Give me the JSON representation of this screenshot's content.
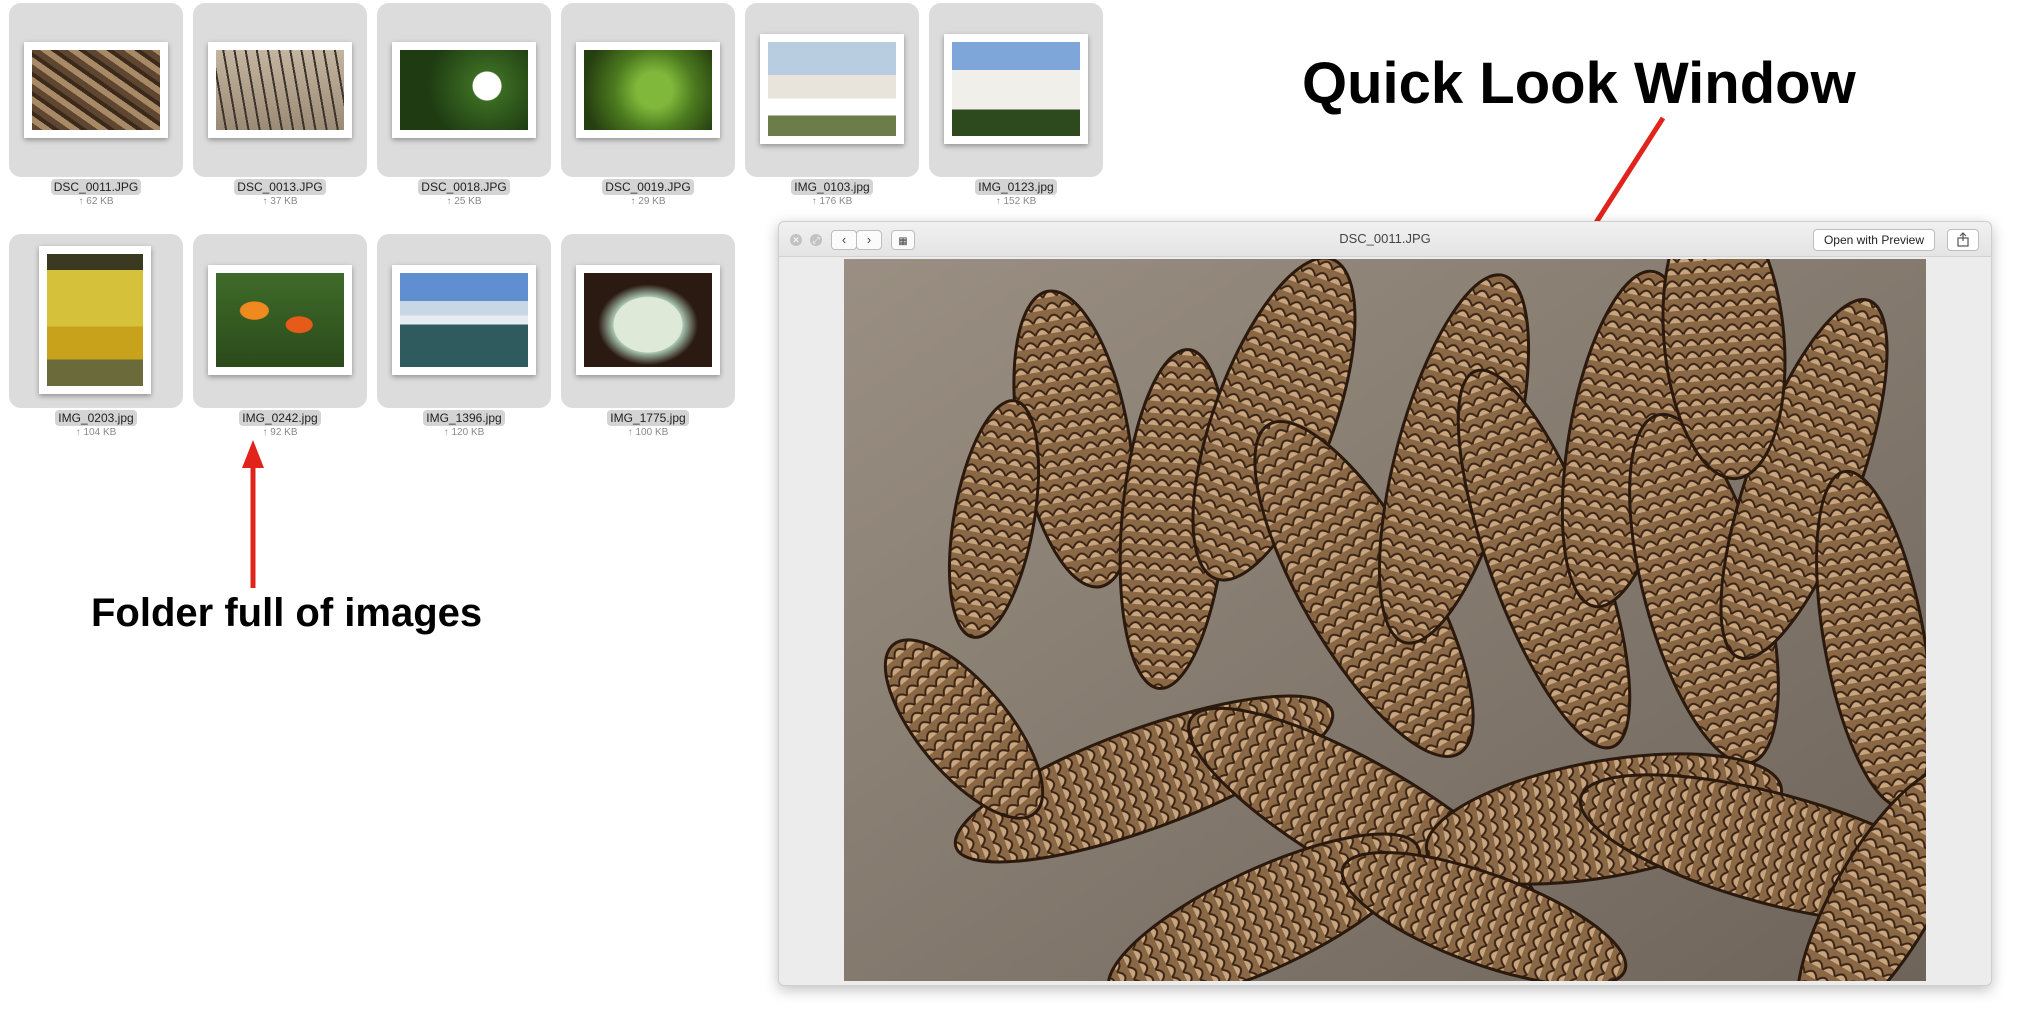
{
  "annotations": {
    "quick_look": "Quick Look Window",
    "folder": "Folder full of images"
  },
  "files": [
    {
      "name": "DSC_0011.JPG",
      "size": "↑ 62 KB",
      "icon": "pinecones-thumbnail"
    },
    {
      "name": "DSC_0013.JPG",
      "size": "↑ 37 KB",
      "icon": "grass-seedheads-thumbnail"
    },
    {
      "name": "DSC_0018.JPG",
      "size": "↑ 25 KB",
      "icon": "trillium-flower-thumbnail"
    },
    {
      "name": "DSC_0019.JPG",
      "size": "↑ 29 KB",
      "icon": "green-plant-thumbnail"
    },
    {
      "name": "IMG_0103.jpg",
      "size": "↑ 176 KB",
      "icon": "house-fence-thumbnail"
    },
    {
      "name": "IMG_0123.jpg",
      "size": "↑ 152 KB",
      "icon": "white-house-thumbnail"
    },
    {
      "name": "IMG_0203.jpg",
      "size": "↑ 104 KB",
      "icon": "honey-tin-thumbnail"
    },
    {
      "name": "IMG_0242.jpg",
      "size": "↑ 92 KB",
      "icon": "tulips-thumbnail"
    },
    {
      "name": "IMG_1396.jpg",
      "size": "↑ 120 KB",
      "icon": "waterfall-thumbnail"
    },
    {
      "name": "IMG_1775.jpg",
      "size": "↑ 100 KB",
      "icon": "radio-thumbnail"
    }
  ],
  "quicklook": {
    "title": "DSC_0011.JPG",
    "open_button": "Open with Preview",
    "close_icon": "close-icon",
    "fullscreen_icon": "fullscreen-icon",
    "prev_icon": "chevron-left-icon",
    "next_icon": "chevron-right-icon",
    "index_icon": "index-sheet-icon",
    "share_icon": "share-icon",
    "image_icon": "pinecones-photo"
  },
  "colors": {
    "arrow": "#e0241b",
    "tile_bg": "#dcdcdc"
  }
}
